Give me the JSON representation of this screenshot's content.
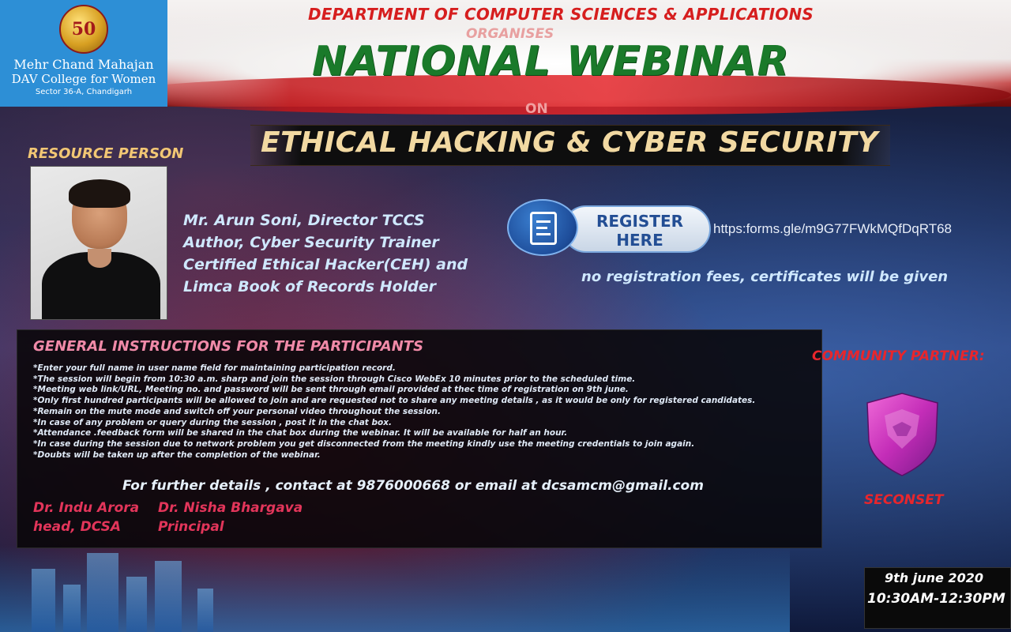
{
  "header": {
    "college_line1": "Mehr Chand Mahajan",
    "college_line2": "DAV College for Women",
    "college_line3": "Sector 36-A, Chandigarh",
    "emblem_text": "50",
    "department": "DEPARTMENT OF COMPUTER SCIENCES & APPLICATIONS",
    "organises": "ORGANISES",
    "event_type": "NATIONAL WEBINAR",
    "on": "ON",
    "topic": "ETHICAL HACKING &  CYBER SECURITY"
  },
  "resource": {
    "label": "RESOURCE PERSON",
    "lines": [
      "Mr.  Arun Soni, Director TCCS",
      "Author, Cyber Security Trainer",
      "Certified Ethical Hacker(CEH) and",
      "Limca Book of Records Holder"
    ]
  },
  "registration": {
    "button_line1": "REGISTER",
    "button_line2": "HERE",
    "url": "https:forms.gle/m9G77FWkMQfDqRT68",
    "note": "no registration fees, certificates will be given"
  },
  "instructions": {
    "title": "GENERAL INSTRUCTIONS FOR THE PARTICIPANTS",
    "items": [
      "*Enter your full name in user name field for maintaining participation record.",
      "*The session will begin from 10:30 a.m. sharp and join the session through Cisco WebEx 10 minutes prior to the scheduled time.",
      "*Meeting web link/URL, Meeting no. and password will be sent through email provided at thec time of registration on 9th june.",
      "*Only first hundred participants will be allowed to join and are requested not to share any meeting details , as it would be only for registered candidates.",
      "*Remain on the mute mode and switch off your personal video throughout the session.",
      "*In case of any problem or query during the session , post it in the chat box.",
      "*Attendance .feedback  form will be shared in the chat box during the webinar. It will be available for half an hour.",
      "*In case during the session due to network problem you get disconnected from the meeting kindly use the meeting credentials to join again.",
      "*Doubts will be taken up after the completion of the webinar."
    ],
    "contact": "For further details , contact  at 9876000668 or email at dcsamcm@gmail.com",
    "signer1_name": "Dr. Indu Arora",
    "signer1_role": "head, DCSA",
    "signer2_name": "Dr. Nisha Bhargava",
    "signer2_role": "Principal"
  },
  "partner": {
    "label": "COMMUNITY PARTNER:",
    "name": "SECONSET"
  },
  "schedule": {
    "date": "9th june 2020",
    "time": "10:30AM-12:30PM"
  },
  "colors": {
    "logo_bg": "#2d8fd6",
    "department": "#d61e1e",
    "title_green": "#1a7a2a",
    "topic_gold": "#f2d9a2",
    "accent_red": "#e8262c"
  }
}
